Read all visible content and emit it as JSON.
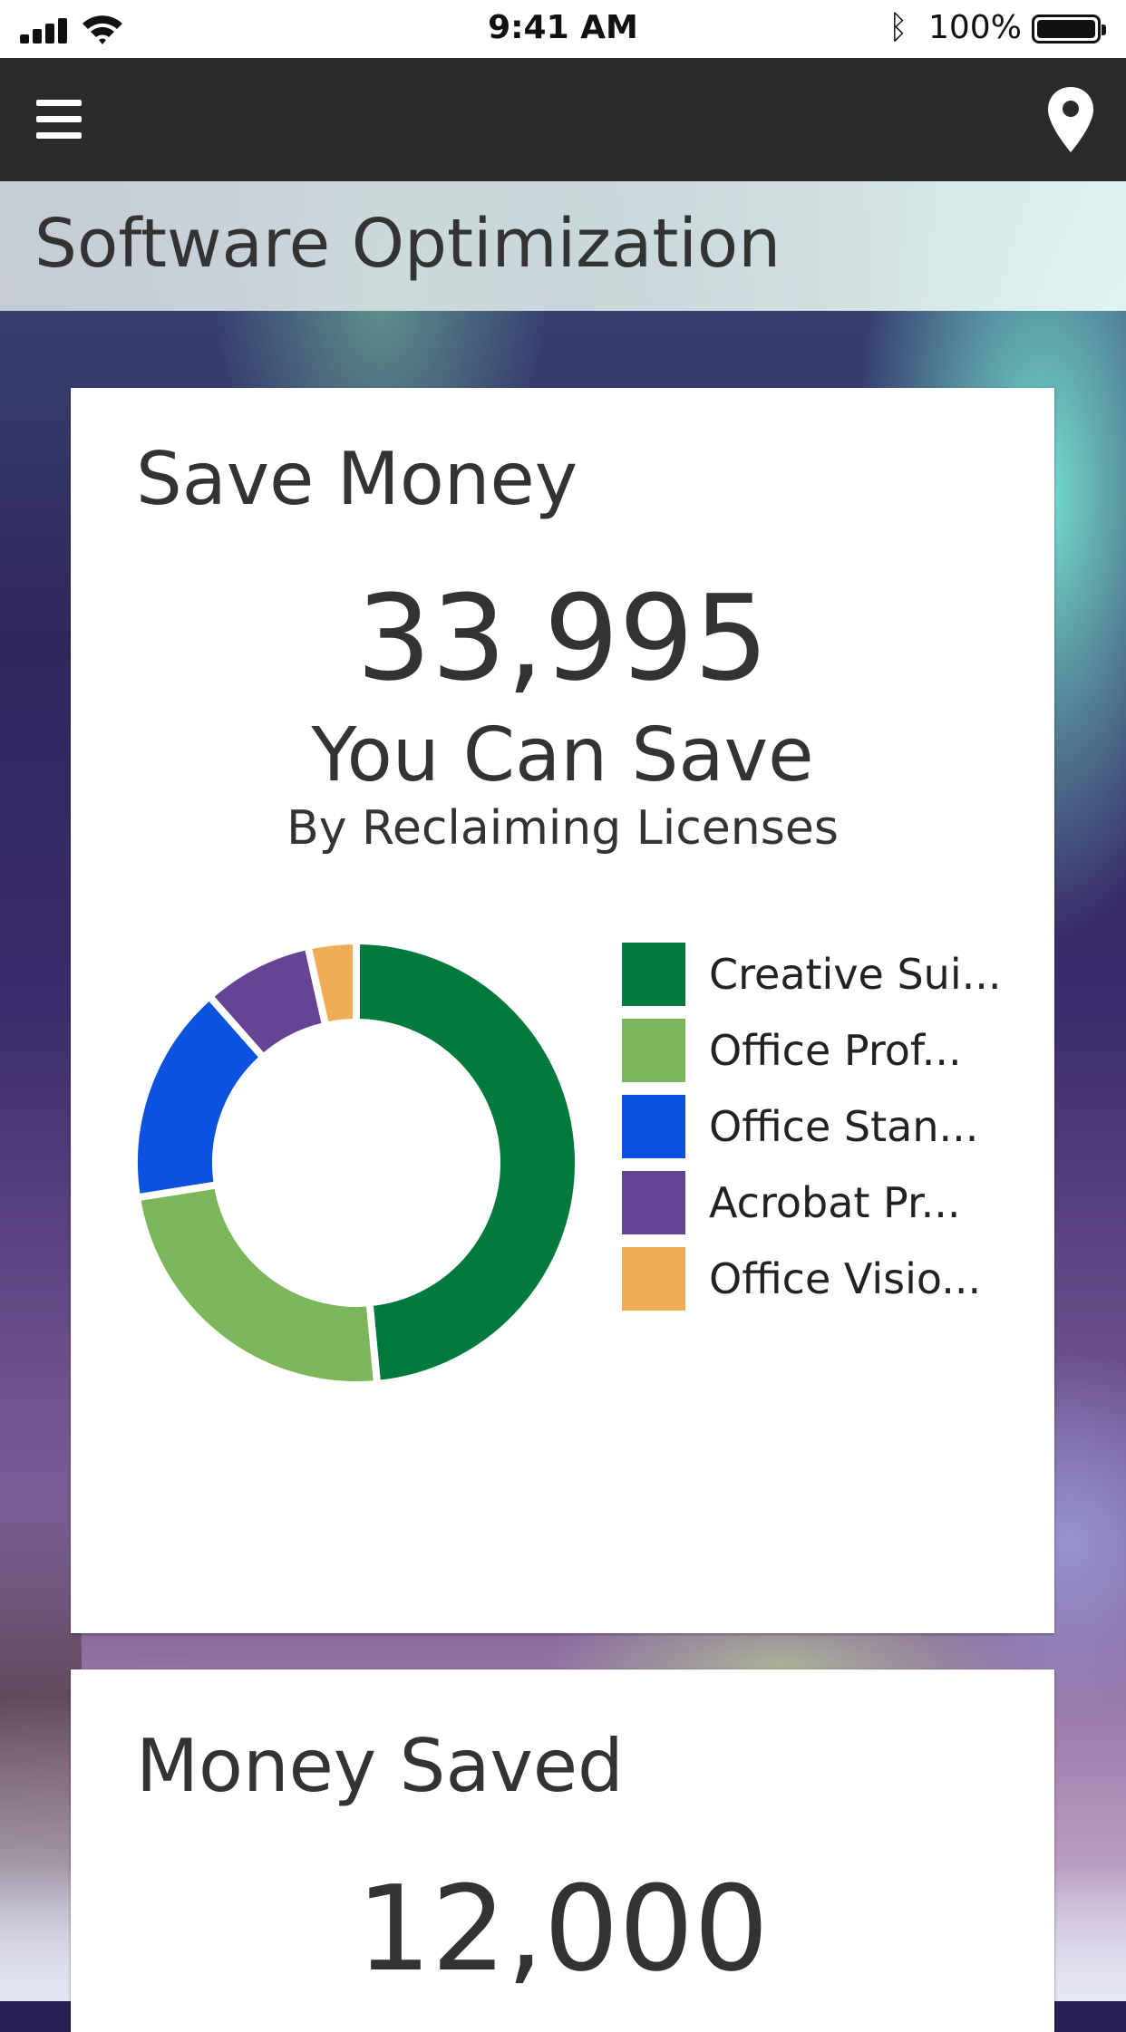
{
  "status_bar": {
    "time": "9:41 AM",
    "battery": "100%"
  },
  "page": {
    "title": "Software Optimization"
  },
  "save_card": {
    "title": "Save Money",
    "amount": "33,995",
    "subtitle": "You Can Save",
    "caption": "By Reclaiming Licenses"
  },
  "saved_card": {
    "title": "Money Saved",
    "amount": "12,000"
  },
  "colors": {
    "nav_bg": "#2b2b2b",
    "dark_green": "#00793d",
    "light_green": "#7cb65a",
    "blue": "#0b52de",
    "purple": "#664394",
    "orange": "#f0ad55"
  },
  "chart_data": {
    "type": "pie",
    "donut": true,
    "labels": [
      "Creative Sui...",
      "Office Prof...",
      "Office Stan...",
      "Acrobat Pr...",
      "Office Visio..."
    ],
    "values": [
      48.5,
      24,
      16,
      8,
      3.5
    ],
    "colors": [
      "#00793d",
      "#7cb65a",
      "#0b52de",
      "#664394",
      "#f0ad55"
    ],
    "legend_position": "right"
  }
}
